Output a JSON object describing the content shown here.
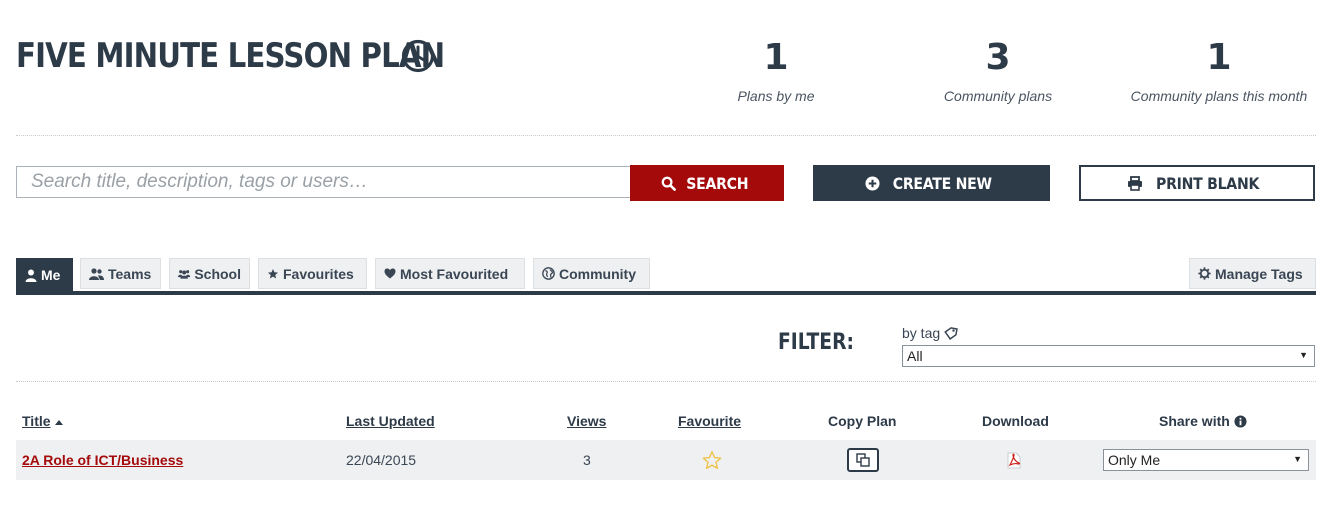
{
  "header": {
    "title": "FIVE MINUTE LESSON PLAN",
    "title_icon": "clock-icon"
  },
  "stats": [
    {
      "value": "1",
      "label": "Plans by me"
    },
    {
      "value": "3",
      "label": "Community plans"
    },
    {
      "value": "1",
      "label": "Community plans this month"
    }
  ],
  "search": {
    "placeholder": "Search title, description, tags or users…",
    "value": "",
    "button_label": "SEARCH"
  },
  "actions": {
    "create_label": "CREATE NEW",
    "print_label": "PRINT BLANK"
  },
  "tabs": [
    {
      "label": "Me",
      "icon": "user-icon",
      "active": true
    },
    {
      "label": "Teams",
      "icon": "users-icon"
    },
    {
      "label": "School",
      "icon": "group-icon"
    },
    {
      "label": "Favourites",
      "icon": "star-icon"
    },
    {
      "label": "Most Favourited",
      "icon": "heart-icon"
    },
    {
      "label": "Community",
      "icon": "globe-icon"
    }
  ],
  "manage_tags_label": "Manage Tags",
  "filter": {
    "label": "FILTER:",
    "by_tag_label": "by tag",
    "selected": "All"
  },
  "table": {
    "columns": {
      "title": "Title",
      "last_updated": "Last Updated",
      "views": "Views",
      "favourite": "Favourite",
      "copy_plan": "Copy Plan",
      "download": "Download",
      "share_with": "Share with"
    },
    "rows": [
      {
        "title": "2A Role of ICT/Business",
        "last_updated": "22/04/2015",
        "views": "3",
        "favourite": false,
        "share_with": "Only Me"
      }
    ]
  },
  "colors": {
    "primary": "#2d3a48",
    "accent_red": "#a50a0a",
    "tab_bg": "#eef0f2",
    "star": "#f0c24a"
  }
}
